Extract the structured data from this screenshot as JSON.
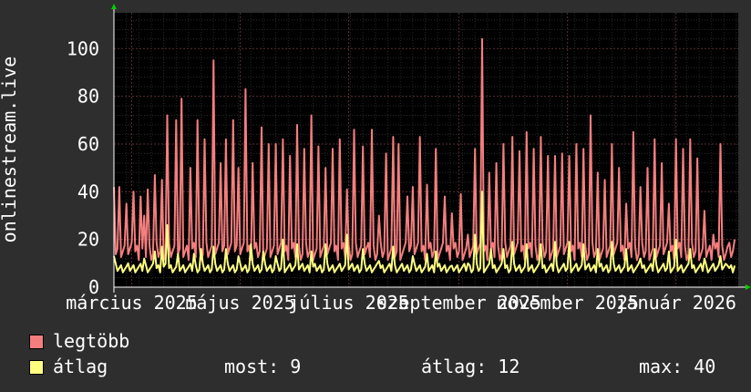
{
  "chart_data": {
    "type": "line",
    "ylabel": "onlinestream.live",
    "ylim": [
      0,
      115
    ],
    "yticks": [
      0,
      20,
      40,
      60,
      80,
      100
    ],
    "x_tick_labels": [
      "március 2025",
      "május 2025",
      "július 2025",
      "szeptember 2025",
      "november 2025",
      "január 2026"
    ],
    "x_tick_days": [
      10,
      71,
      132,
      194,
      255,
      316
    ],
    "x_range_days": [
      0,
      351
    ],
    "grid": true,
    "series": [
      {
        "name": "legtöbb",
        "color": "#f47e7e",
        "peaks": [
          [
            0,
            42
          ],
          [
            3,
            42
          ],
          [
            7,
            35
          ],
          [
            11,
            40
          ],
          [
            15,
            38
          ],
          [
            17,
            30
          ],
          [
            19,
            41
          ],
          [
            23,
            47
          ],
          [
            27,
            45
          ],
          [
            30,
            72
          ],
          [
            35,
            70
          ],
          [
            38,
            79
          ],
          [
            43,
            50
          ],
          [
            47,
            70
          ],
          [
            51,
            62
          ],
          [
            56,
            95
          ],
          [
            60,
            52
          ],
          [
            63,
            62
          ],
          [
            67,
            70
          ],
          [
            70,
            50
          ],
          [
            74,
            83
          ],
          [
            78,
            52
          ],
          [
            83,
            67
          ],
          [
            87,
            60
          ],
          [
            91,
            60
          ],
          [
            95,
            62
          ],
          [
            99,
            55
          ],
          [
            103,
            68
          ],
          [
            107,
            58
          ],
          [
            111,
            72
          ],
          [
            115,
            59
          ],
          [
            119,
            50
          ],
          [
            123,
            58
          ],
          [
            127,
            62
          ],
          [
            131,
            41
          ],
          [
            135,
            66
          ],
          [
            140,
            59
          ],
          [
            145,
            66
          ],
          [
            149,
            30
          ],
          [
            153,
            56
          ],
          [
            157,
            63
          ],
          [
            160,
            60
          ],
          [
            165,
            38
          ],
          [
            168,
            42
          ],
          [
            172,
            63
          ],
          [
            176,
            43
          ],
          [
            181,
            58
          ],
          [
            186,
            38
          ],
          [
            190,
            31
          ],
          [
            195,
            39
          ],
          [
            199,
            22
          ],
          [
            203,
            58
          ],
          [
            207,
            104
          ],
          [
            211,
            48
          ],
          [
            215,
            52
          ],
          [
            219,
            60
          ],
          [
            224,
            63
          ],
          [
            228,
            57
          ],
          [
            232,
            65
          ],
          [
            236,
            58
          ],
          [
            240,
            63
          ],
          [
            244,
            55
          ],
          [
            248,
            55
          ],
          [
            252,
            56
          ],
          [
            256,
            55
          ],
          [
            260,
            60
          ],
          [
            264,
            58
          ],
          [
            268,
            72
          ],
          [
            272,
            48
          ],
          [
            276,
            45
          ],
          [
            280,
            60
          ],
          [
            284,
            50
          ],
          [
            288,
            35
          ],
          [
            292,
            65
          ],
          [
            296,
            42
          ],
          [
            300,
            50
          ],
          [
            304,
            62
          ],
          [
            308,
            52
          ],
          [
            312,
            35
          ],
          [
            316,
            62
          ],
          [
            320,
            58
          ],
          [
            324,
            62
          ],
          [
            328,
            54
          ],
          [
            332,
            32
          ],
          [
            337,
            22
          ],
          [
            341,
            60
          ],
          [
            345,
            17
          ],
          [
            349,
            20
          ]
        ],
        "base": 15
      },
      {
        "name": "átlag",
        "color": "#ffff80",
        "peaks": [
          [
            0,
            13
          ],
          [
            8,
            10
          ],
          [
            17,
            12
          ],
          [
            23,
            15
          ],
          [
            27,
            17
          ],
          [
            30,
            26
          ],
          [
            36,
            14
          ],
          [
            45,
            14
          ],
          [
            49,
            16
          ],
          [
            56,
            17
          ],
          [
            63,
            16
          ],
          [
            70,
            13
          ],
          [
            77,
            18
          ],
          [
            84,
            15
          ],
          [
            91,
            13
          ],
          [
            95,
            20
          ],
          [
            103,
            18
          ],
          [
            111,
            15
          ],
          [
            119,
            18
          ],
          [
            131,
            22
          ],
          [
            140,
            16
          ],
          [
            149,
            11
          ],
          [
            157,
            17
          ],
          [
            168,
            13
          ],
          [
            176,
            14
          ],
          [
            181,
            15
          ],
          [
            190,
            9
          ],
          [
            199,
            10
          ],
          [
            203,
            22
          ],
          [
            207,
            40
          ],
          [
            212,
            16
          ],
          [
            219,
            16
          ],
          [
            224,
            19
          ],
          [
            232,
            18
          ],
          [
            240,
            18
          ],
          [
            248,
            19
          ],
          [
            256,
            19
          ],
          [
            264,
            18
          ],
          [
            272,
            16
          ],
          [
            280,
            19
          ],
          [
            288,
            16
          ],
          [
            296,
            12
          ],
          [
            304,
            16
          ],
          [
            312,
            15
          ],
          [
            316,
            20
          ],
          [
            324,
            16
          ],
          [
            332,
            12
          ],
          [
            341,
            13
          ],
          [
            345,
            9
          ],
          [
            349,
            9
          ]
        ],
        "base": 8
      }
    ]
  },
  "legend": {
    "max_label": "legtöbb",
    "avg_label": "átlag",
    "now_label": "most: 9",
    "avg_stat": "átlag: 12",
    "max_stat": "max: 40"
  }
}
